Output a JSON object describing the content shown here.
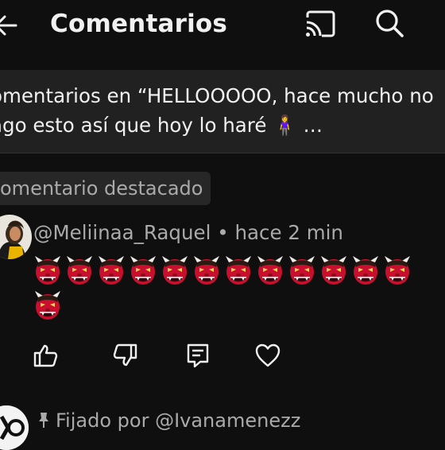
{
  "header": {
    "title": "Comentarios",
    "icons": [
      "back-arrow-icon",
      "cast-icon",
      "search-icon"
    ]
  },
  "context": {
    "text": "Comentarios en “HELLOOOOO, hace mucho no hago esto así que hoy lo haré 🧍‍♀️ …",
    "line1": "omentarios en “HELLOOOOO, hace mucho no",
    "line2": "ago esto así que hoy lo haré 🧍‍♀️ …"
  },
  "featured_chip": {
    "label": "omentario destacado"
  },
  "comment": {
    "author": "@Meliinaa_Raquel",
    "separator": "•",
    "time": "hace 2 min",
    "emoji_count": 13,
    "emoji_char": "👹",
    "actions": [
      "like-icon",
      "dislike-icon",
      "reply-icon",
      "heart-icon"
    ]
  },
  "pinned": {
    "label": "Fijado por @Ivanamenezz"
  },
  "colors": {
    "background": "#0f0f0f",
    "band": "#212121",
    "chip": "#272727",
    "secondary_text": "#aaaaaa",
    "primary_text": "#f1f1f1",
    "ogre_red": "#c8102e"
  }
}
